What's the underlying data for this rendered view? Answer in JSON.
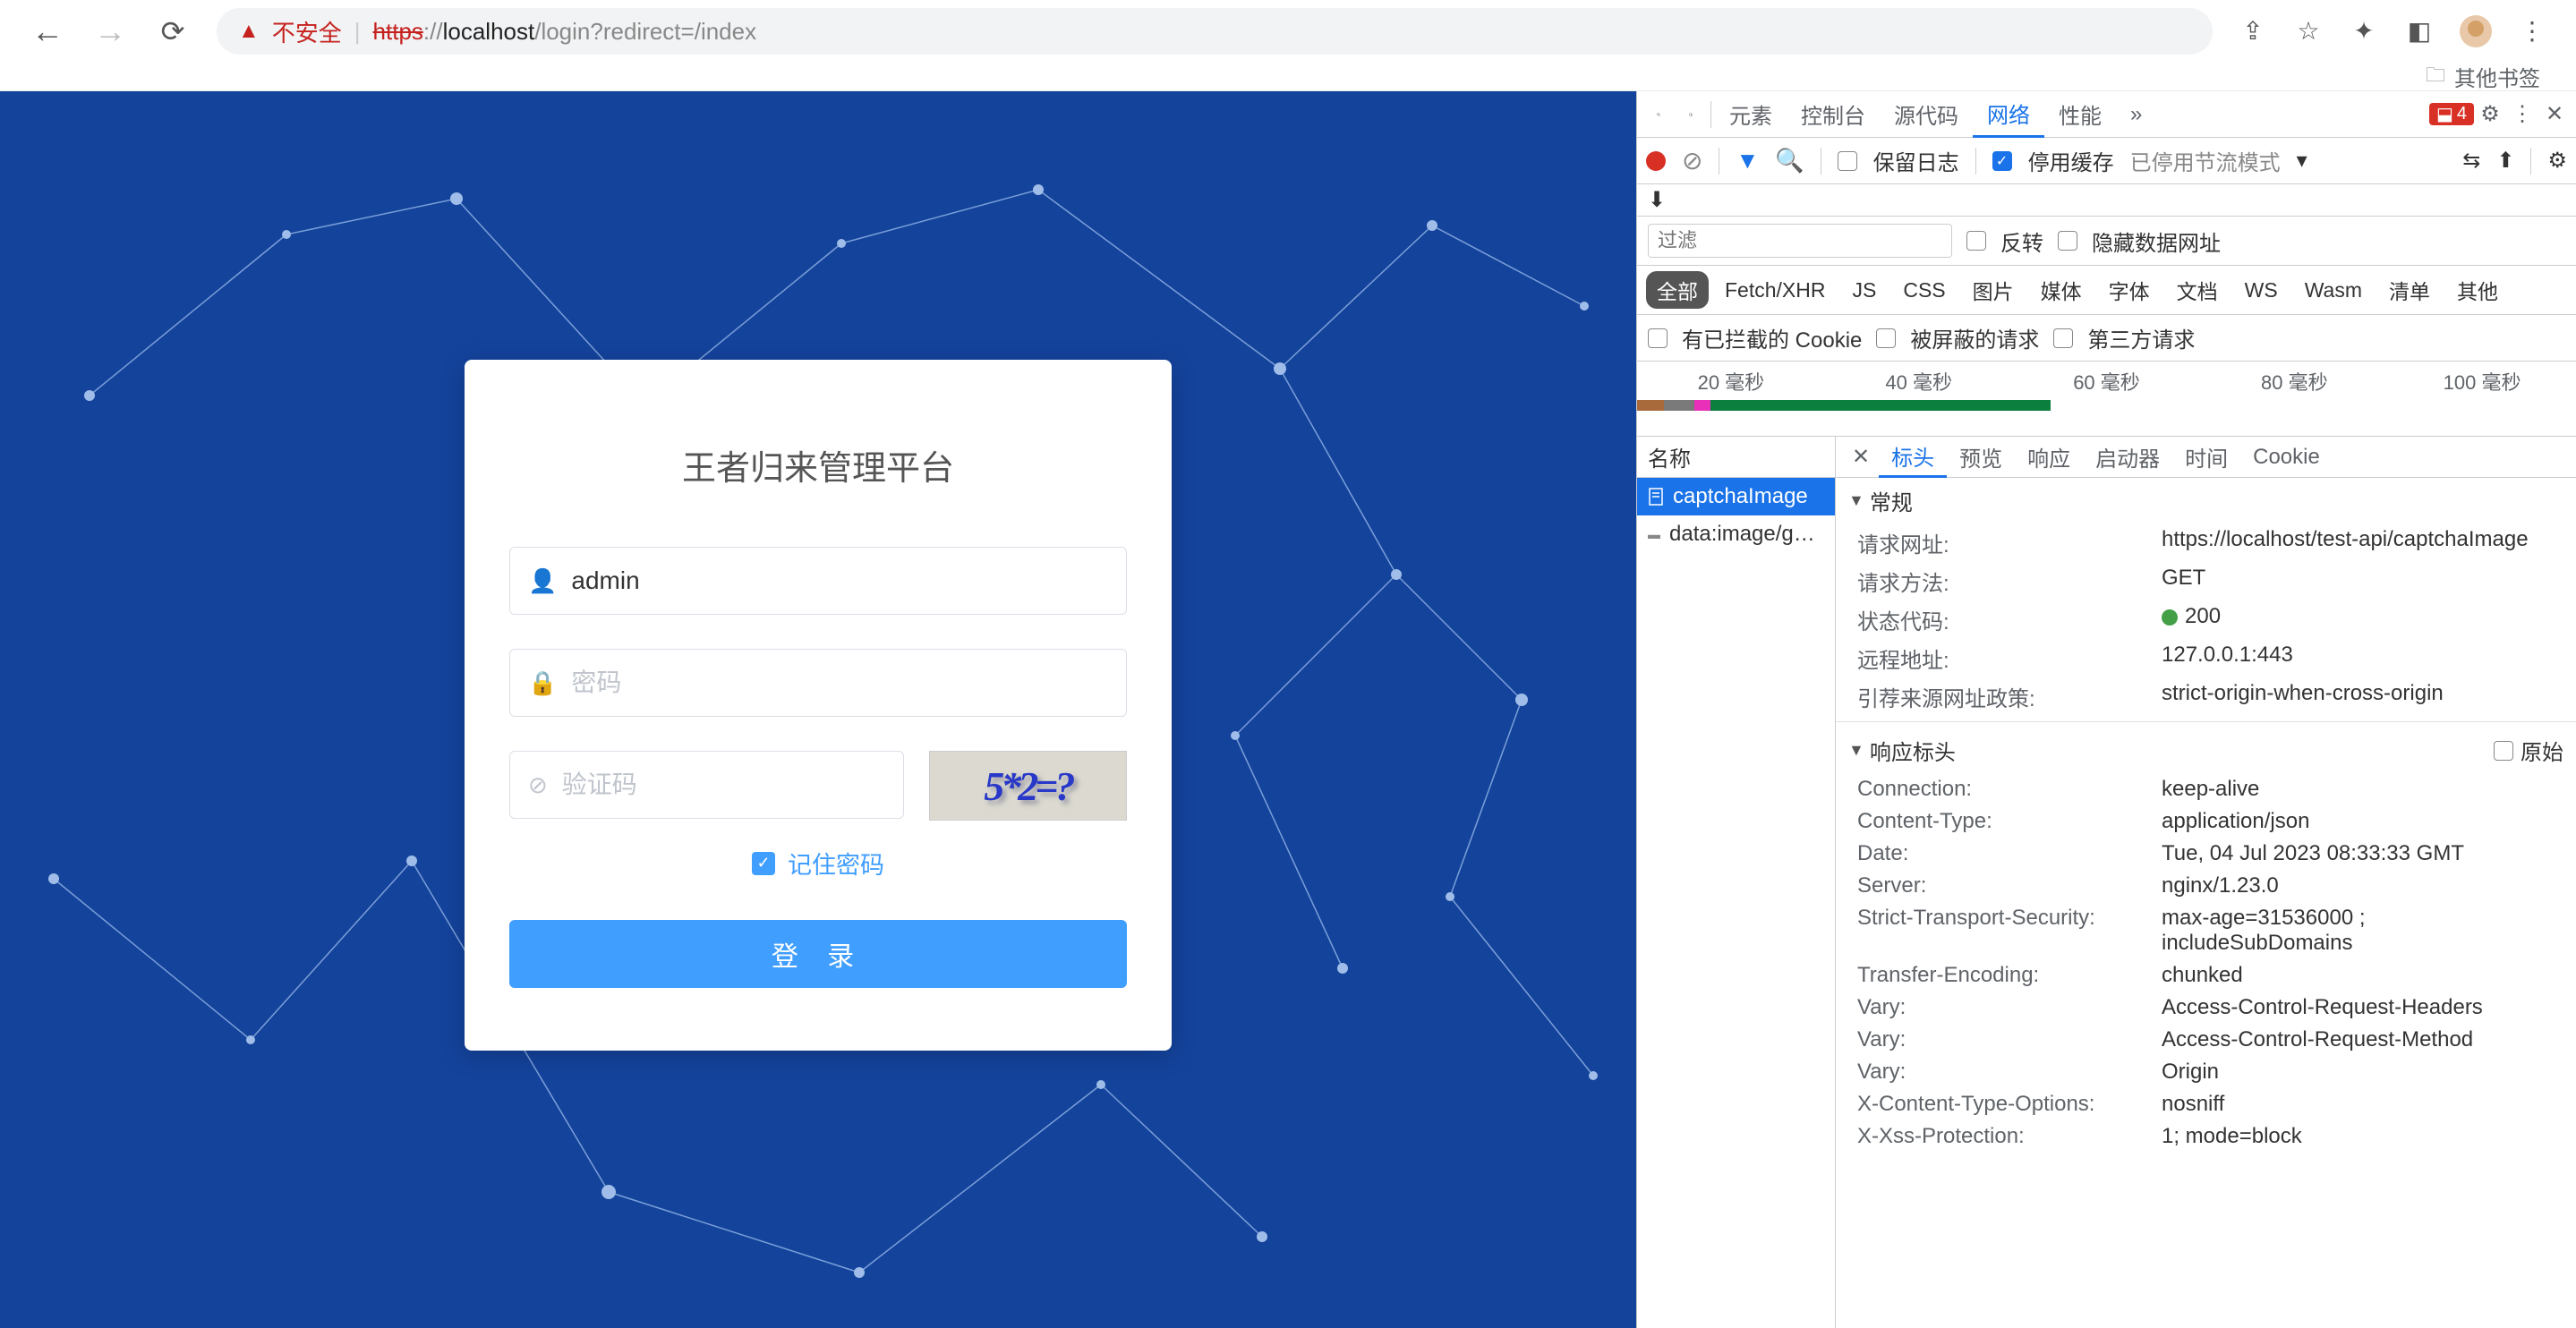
{
  "chrome": {
    "nosec_label": "不安全",
    "url_scheme": "https",
    "url_host": "localhost",
    "url_path": "/login?redirect=/index",
    "other_bookmarks": "其他书签"
  },
  "login": {
    "title": "王者归来管理平台",
    "username_value": "admin",
    "password_placeholder": "密码",
    "captcha_placeholder": "验证码",
    "captcha_text": "5*2=?",
    "remember_label": "记住密码",
    "login_btn": "登 录"
  },
  "devtools": {
    "tabs": {
      "elements": "元素",
      "console": "控制台",
      "sources": "源代码",
      "network": "网络",
      "performance": "性能"
    },
    "error_count": "4",
    "keep_log": "保留日志",
    "disable_cache": "停用缓存",
    "throttle": "已停用节流模式",
    "filter_placeholder": "过滤",
    "invert": "反转",
    "hide_urls": "隐藏数据网址",
    "types": {
      "all": "全部",
      "fetch": "Fetch/XHR",
      "js": "JS",
      "css": "CSS",
      "img": "图片",
      "media": "媒体",
      "font": "字体",
      "doc": "文档",
      "ws": "WS",
      "wasm": "Wasm",
      "manifest": "清单",
      "other": "其他"
    },
    "blocked_cookies": "有已拦截的 Cookie",
    "blocked_req": "被屏蔽的请求",
    "thirdparty": "第三方请求",
    "timeline": [
      "20 毫秒",
      "40 毫秒",
      "60 毫秒",
      "80 毫秒",
      "100 毫秒"
    ],
    "name_hdr": "名称",
    "requests": [
      "captchaImage",
      "data:image/g…"
    ],
    "dtabs": {
      "headers": "标头",
      "preview": "预览",
      "response": "响应",
      "initiator": "启动器",
      "timing": "时间",
      "cookies": "Cookie"
    },
    "section_general": "常规",
    "general": {
      "request_url_k": "请求网址:",
      "request_url_v": "https://localhost/test-api/captchaImage",
      "method_k": "请求方法:",
      "method_v": "GET",
      "status_k": "状态代码:",
      "status_v": "200",
      "remote_k": "远程地址:",
      "remote_v": "127.0.0.1:443",
      "referrer_k": "引荐来源网址政策:",
      "referrer_v": "strict-origin-when-cross-origin"
    },
    "section_response": "响应标头",
    "raw_label": "原始",
    "response_headers": [
      {
        "k": "Connection:",
        "v": "keep-alive"
      },
      {
        "k": "Content-Type:",
        "v": "application/json"
      },
      {
        "k": "Date:",
        "v": "Tue, 04 Jul 2023 08:33:33 GMT"
      },
      {
        "k": "Server:",
        "v": "nginx/1.23.0"
      },
      {
        "k": "Strict-Transport-Security:",
        "v": "max-age=31536000 ; includeSubDomains"
      },
      {
        "k": "Transfer-Encoding:",
        "v": "chunked"
      },
      {
        "k": "Vary:",
        "v": "Access-Control-Request-Headers"
      },
      {
        "k": "Vary:",
        "v": "Access-Control-Request-Method"
      },
      {
        "k": "Vary:",
        "v": "Origin"
      },
      {
        "k": "X-Content-Type-Options:",
        "v": "nosniff"
      },
      {
        "k": "X-Xss-Protection:",
        "v": "1; mode=block"
      }
    ]
  }
}
